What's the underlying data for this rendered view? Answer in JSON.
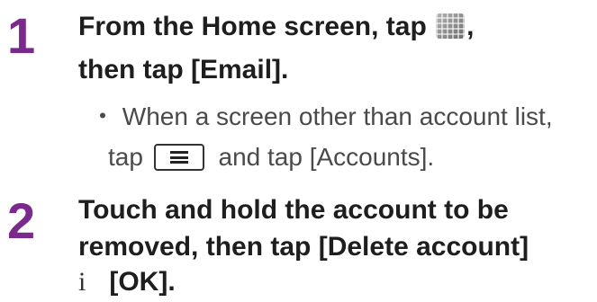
{
  "steps": [
    {
      "number": "1",
      "line1_pre": "From the Home screen, tap",
      "line1_post": ",",
      "line2": "then tap [Email].",
      "note_line1": "・ When a screen other than account list,",
      "note_line2_pre": "tap",
      "note_line2_post": "and tap [Accounts]."
    },
    {
      "number": "2",
      "line1": "Touch and hold the account to be",
      "line2": "removed, then tap [Delete account]",
      "line3_prefix": "i",
      "line3": "[OK]."
    }
  ],
  "icons": {
    "apps": "apps-grid-icon",
    "menu": "menu-key-icon"
  },
  "colors": {
    "step_number": "#7a2a8c",
    "text": "#1e1e1e",
    "note": "#4a4a4a"
  }
}
